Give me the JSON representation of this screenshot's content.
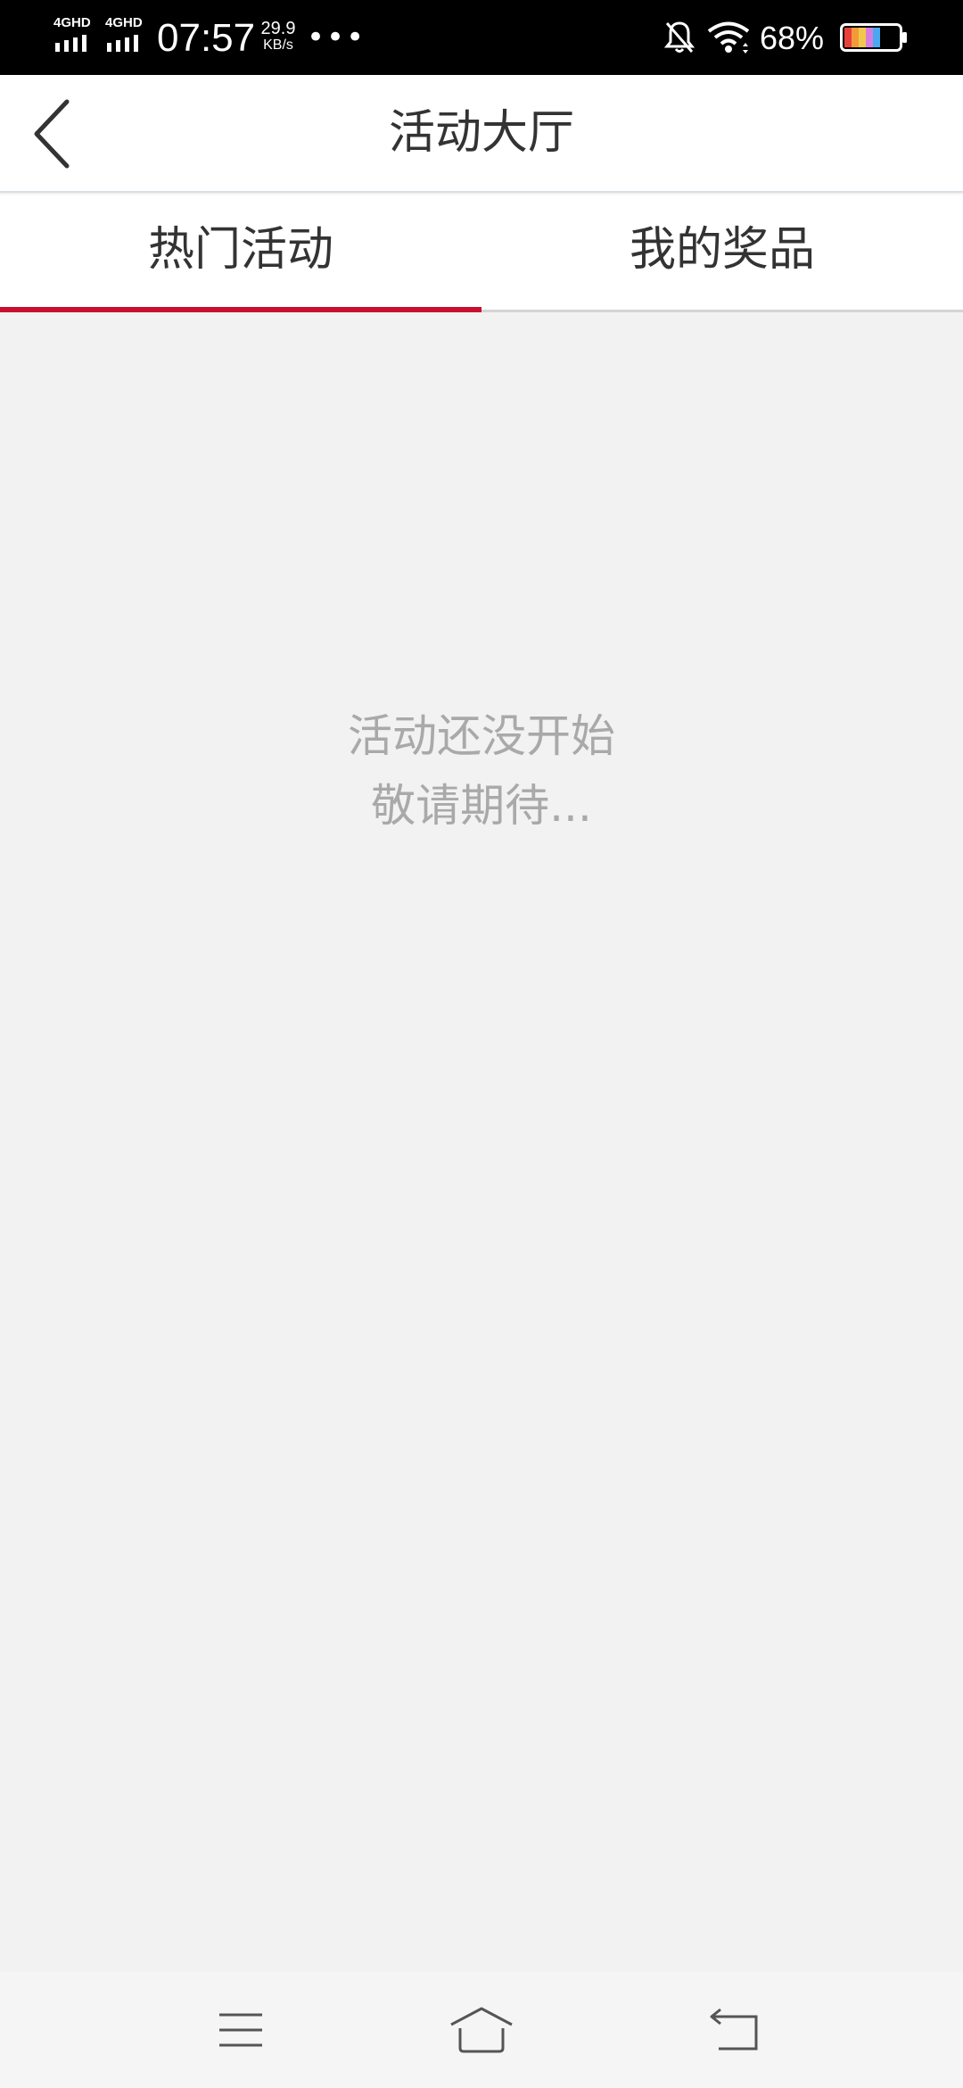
{
  "status_bar": {
    "network1": "4GHD",
    "network2": "4GHD",
    "time": "07:57",
    "speed_value": "29.9",
    "speed_unit": "KB/s",
    "more": "•••",
    "battery_percent": "68%",
    "icons": [
      "signal-icon",
      "signal-icon",
      "bell-off-icon",
      "wifi-icon",
      "battery-icon"
    ]
  },
  "header": {
    "title": "活动大厅",
    "back_icon": "chevron-left-icon"
  },
  "tabs": [
    {
      "label": "热门活动",
      "active": true
    },
    {
      "label": "我的奖品",
      "active": false
    }
  ],
  "content": {
    "empty_line1": "活动还没开始",
    "empty_line2": "敬请期待..."
  },
  "nav_bar": {
    "icons": [
      "menu-icon",
      "home-icon",
      "back-icon"
    ]
  },
  "colors": {
    "accent": "#c8102e",
    "background": "#f2f2f2",
    "empty_text": "#a9a9a9"
  }
}
